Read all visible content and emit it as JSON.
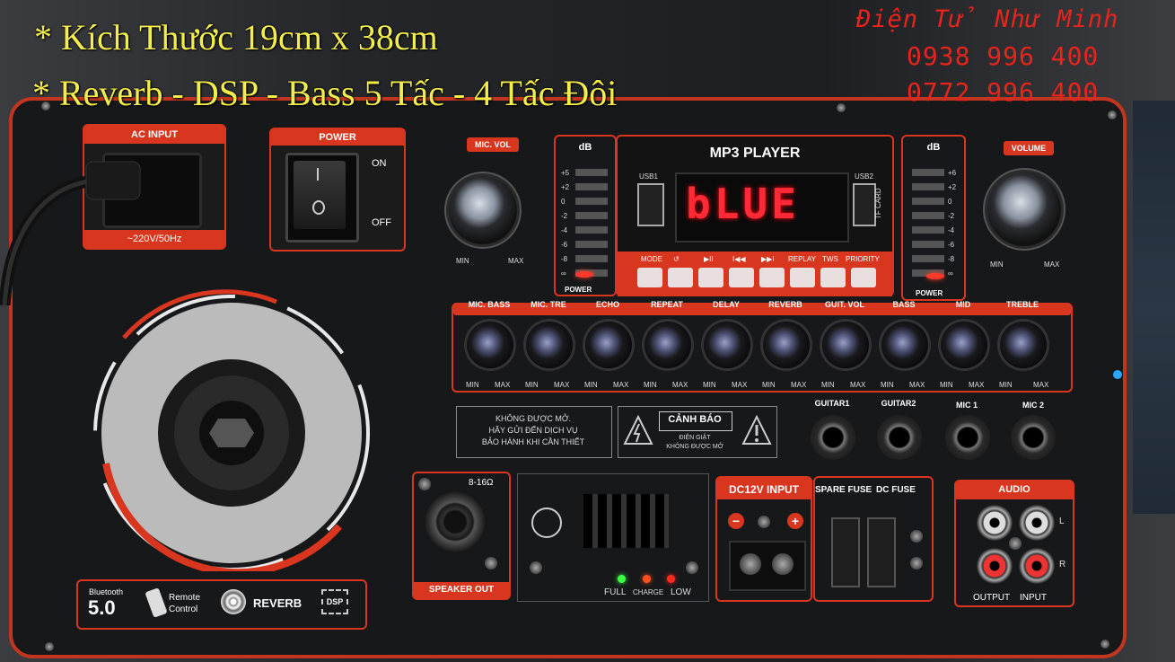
{
  "overlay": {
    "line1": "* Kích Thước 19cm x 38cm",
    "line2": "* Reverb - DSP  -  Bass 5 Tấc - 4 Tấc Đôi",
    "shop_name": "Điện Tử Như Minh",
    "phone1": "0938 996 400",
    "phone2": "0772 996 400"
  },
  "ac_input": {
    "title": "AC INPUT",
    "voltage": "~220V/50Hz"
  },
  "power": {
    "title": "POWER",
    "on": "ON",
    "off": "OFF"
  },
  "mic_vol": {
    "title": "MIC. VOL",
    "min": "MIN",
    "max": "MAX"
  },
  "volume": {
    "title": "VOLUME",
    "min": "MIN",
    "max": "MAX"
  },
  "db_left": {
    "title": "dB",
    "scale": [
      "+5",
      "+2",
      "0",
      "-2",
      "-4",
      "-6",
      "-8",
      "∞"
    ],
    "footer": "POWER"
  },
  "db_right": {
    "title": "dB",
    "scale": [
      "+6",
      "+2",
      "0",
      "-2",
      "-4",
      "-6",
      "-8",
      "∞"
    ],
    "footer": "POWER"
  },
  "mp3": {
    "title": "MP3 PLAYER",
    "usb1": "USB1",
    "usb2": "USB2",
    "tf": "TF CARD",
    "display": "bLUE",
    "buttons": [
      "MODE",
      "↺",
      "▶II",
      "I◀◀",
      "▶▶I",
      "REPLAY",
      "TWS",
      "PRIORITY"
    ]
  },
  "knob_row": {
    "knobs": [
      "MIC. BASS",
      "MIC. TRE",
      "ECHO",
      "REPEAT",
      "DELAY",
      "REVERB",
      "GUIT. VOL",
      "BASS",
      "MID",
      "TREBLE"
    ],
    "min": "MIN",
    "max": "MAX"
  },
  "warning1": {
    "line1": "KHÔNG ĐƯỢC MỞ.",
    "line2": "HÃY GỬI ĐẾN DỊCH VỤ",
    "line3": "BẢO HÀNH KHI CẦN THIẾT"
  },
  "warning2": {
    "title": "CẢNH BÁO",
    "line1": "ĐIỆN GIẬT",
    "line2": "KHÔNG ĐƯỢC MỞ"
  },
  "jacks": [
    "GUITAR1",
    "GUITAR2",
    "MIC 1",
    "MIC 2"
  ],
  "speaker_out": {
    "impedance": "8-16Ω",
    "label": "SPEAKER OUT"
  },
  "charge": {
    "full": "FULL",
    "charge": "CHARGE",
    "low": "LOW"
  },
  "dc": {
    "title": "DC12V INPUT",
    "minus": "−",
    "plus": "+"
  },
  "fuse": {
    "spare": "SPARE FUSE",
    "dc": "DC FUSE"
  },
  "audio": {
    "title": "AUDIO",
    "l": "L",
    "r": "R",
    "output": "OUTPUT",
    "input": "INPUT"
  },
  "badges": {
    "bt_top": "Bluetooth",
    "bt_ver": "5.0",
    "remote1": "Remote",
    "remote2": "Control",
    "reverb": "REVERB",
    "dsp": "DSP"
  },
  "colors": {
    "board_red": "#d8361e",
    "overlay_yellow": "#f4ee4a",
    "overlay_red": "#e8241c",
    "display_red": "#ff2a35"
  }
}
